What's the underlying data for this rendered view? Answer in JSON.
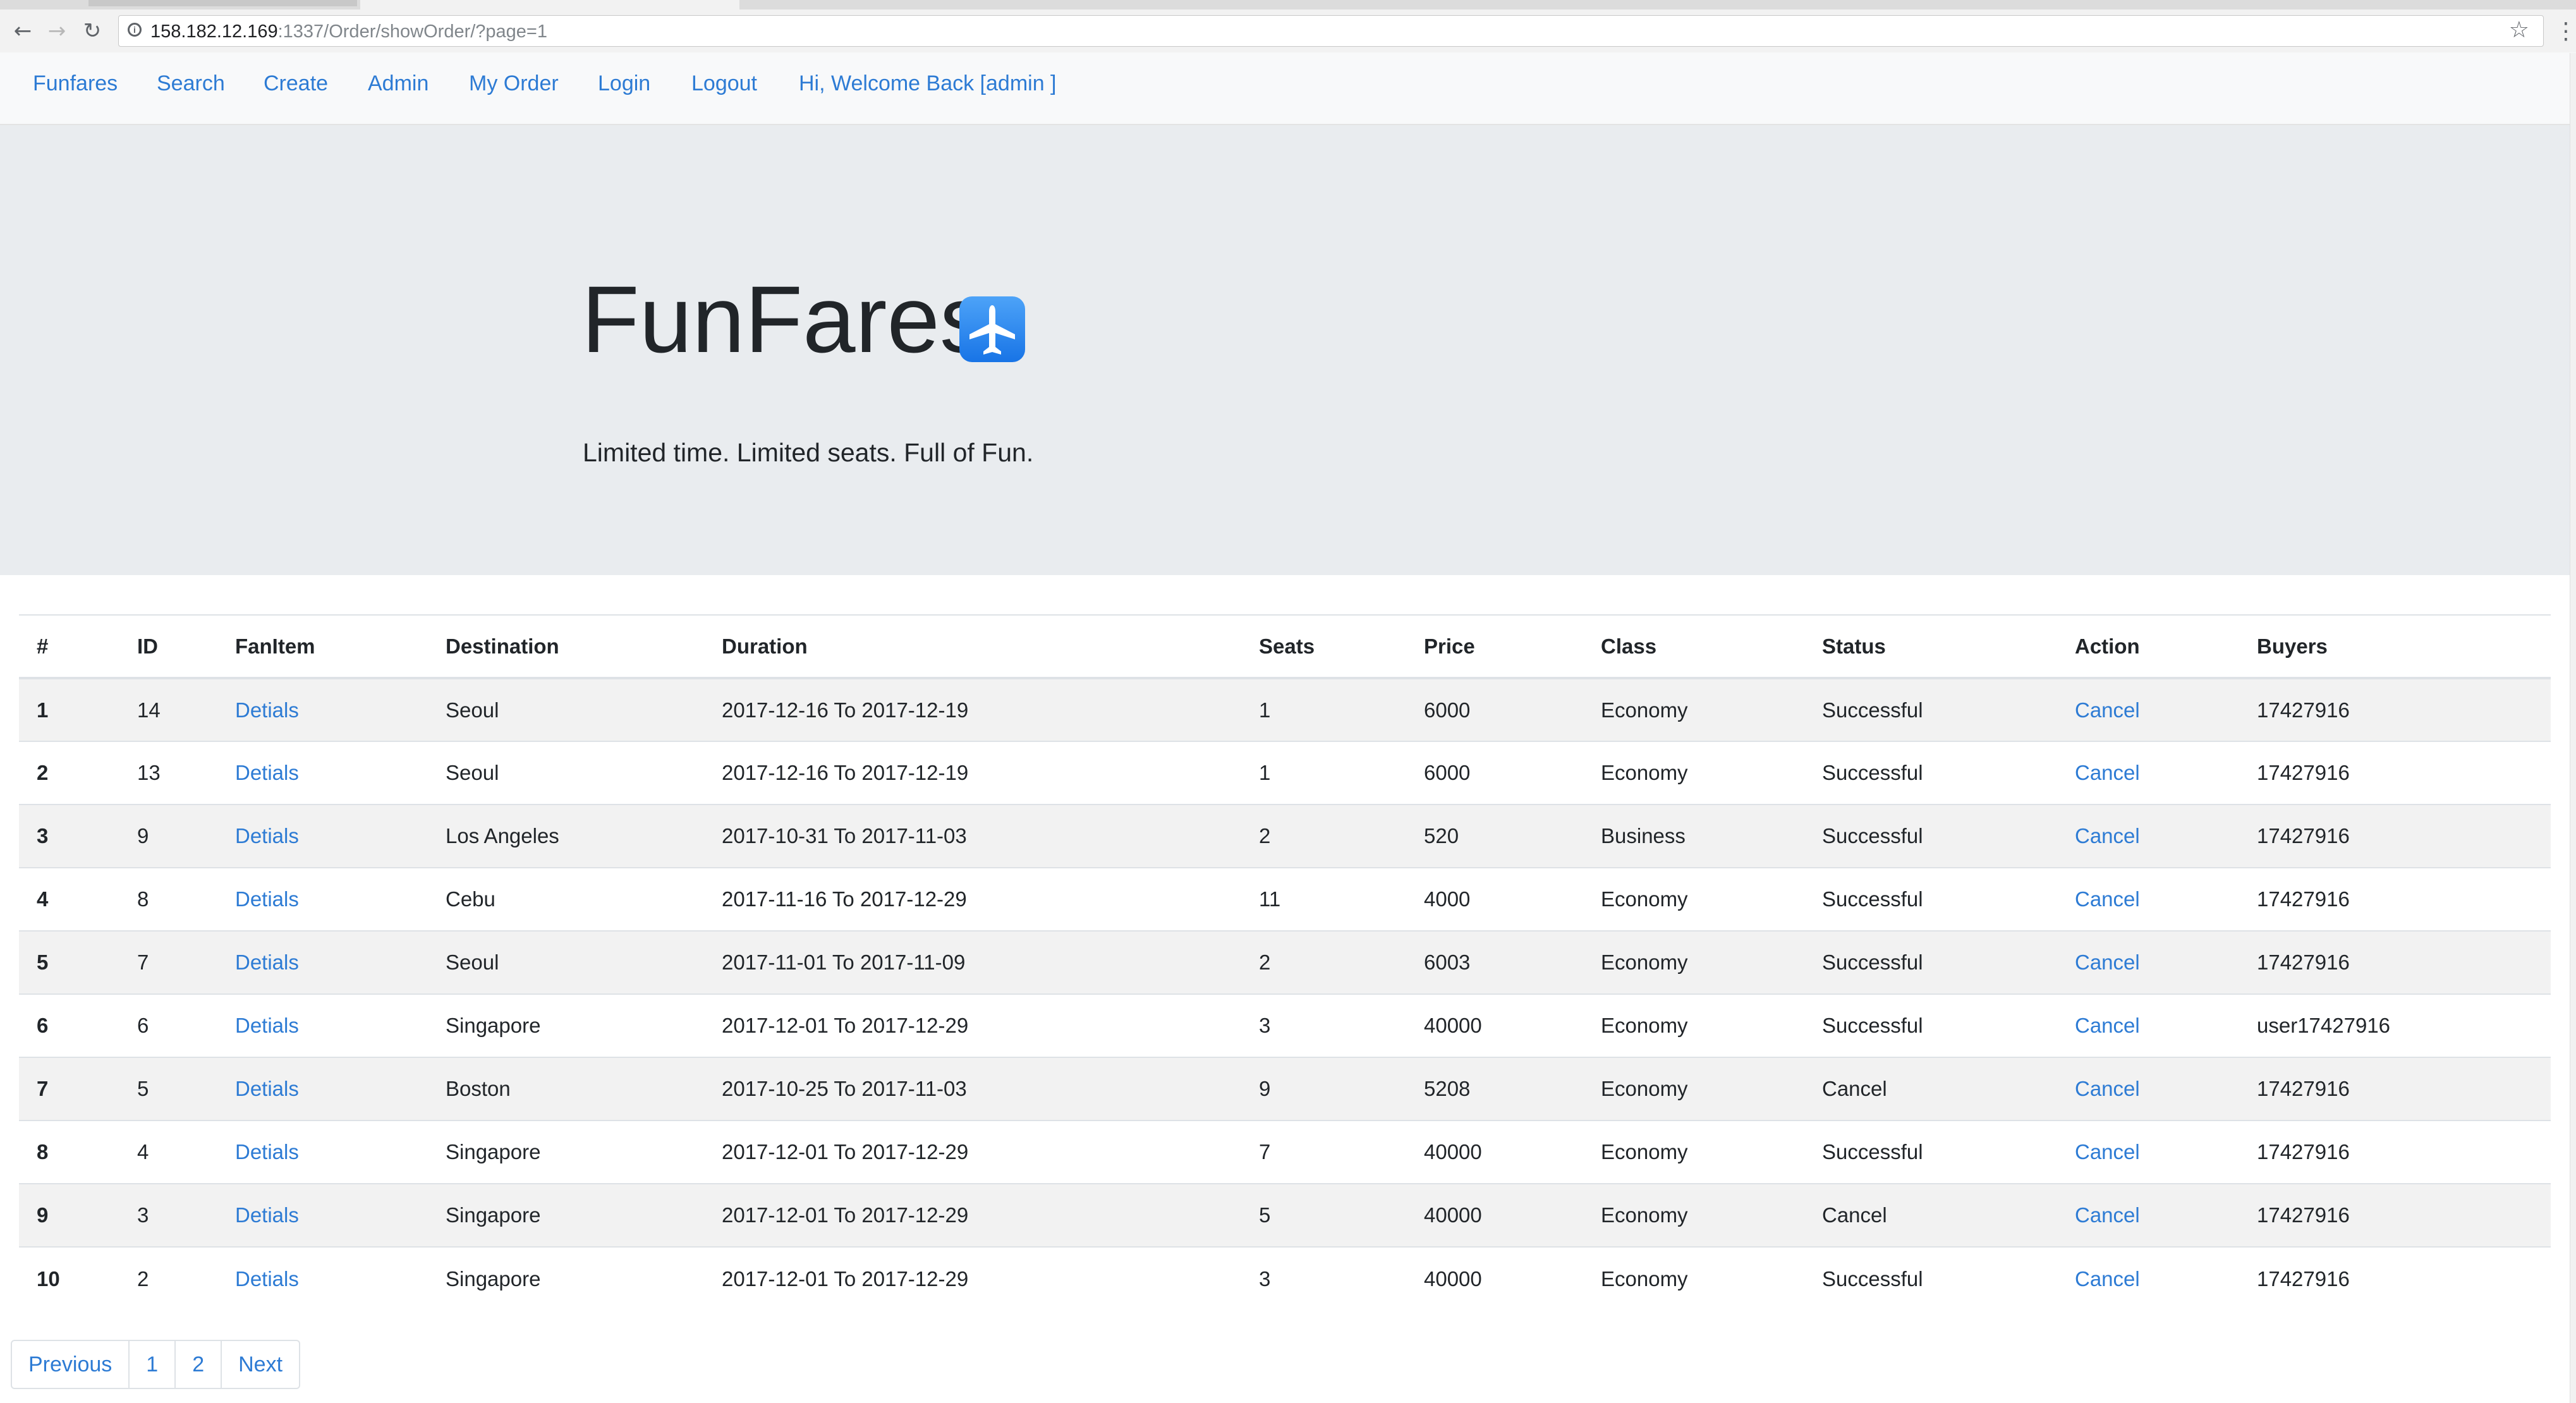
{
  "browser": {
    "url_host": "158.182.12.169",
    "url_path": ":1337/Order/showOrder/?page=1",
    "icons": {
      "back": "back-arrow-icon",
      "forward": "forward-arrow-icon",
      "reload": "reload-icon",
      "info": "info-icon",
      "star": "star-icon",
      "menu": "kebab-menu-icon"
    }
  },
  "navbar": {
    "items": [
      {
        "label": "Funfares"
      },
      {
        "label": "Search"
      },
      {
        "label": "Create"
      },
      {
        "label": "Admin"
      },
      {
        "label": "My Order"
      },
      {
        "label": "Login"
      },
      {
        "label": "Logout"
      },
      {
        "label": "Hi, Welcome Back [admin ]"
      }
    ]
  },
  "jumbotron": {
    "title": "FunFares",
    "icon": "airplane-icon",
    "lead": "Limited time. Limited seats. Full of Fun."
  },
  "table": {
    "columns": [
      "#",
      "ID",
      "FanItem",
      "Destination",
      "Duration",
      "Seats",
      "Price",
      "Class",
      "Status",
      "Action",
      "Buyers"
    ],
    "rows": [
      {
        "num": "1",
        "id": "14",
        "item": "Detials",
        "dest": "Seoul",
        "duration": "2017-12-16 To 2017-12-19",
        "seats": "1",
        "price": "6000",
        "class": "Economy",
        "status": "Successful",
        "action": "Cancel",
        "buyer": "17427916"
      },
      {
        "num": "2",
        "id": "13",
        "item": "Detials",
        "dest": "Seoul",
        "duration": "2017-12-16 To 2017-12-19",
        "seats": "1",
        "price": "6000",
        "class": "Economy",
        "status": "Successful",
        "action": "Cancel",
        "buyer": "17427916"
      },
      {
        "num": "3",
        "id": "9",
        "item": "Detials",
        "dest": "Los Angeles",
        "duration": "2017-10-31 To 2017-11-03",
        "seats": "2",
        "price": "520",
        "class": "Business",
        "status": "Successful",
        "action": "Cancel",
        "buyer": "17427916"
      },
      {
        "num": "4",
        "id": "8",
        "item": "Detials",
        "dest": "Cebu",
        "duration": "2017-11-16 To 2017-12-29",
        "seats": "11",
        "price": "4000",
        "class": "Economy",
        "status": "Successful",
        "action": "Cancel",
        "buyer": "17427916"
      },
      {
        "num": "5",
        "id": "7",
        "item": "Detials",
        "dest": "Seoul",
        "duration": "2017-11-01 To 2017-11-09",
        "seats": "2",
        "price": "6003",
        "class": "Economy",
        "status": "Successful",
        "action": "Cancel",
        "buyer": "17427916"
      },
      {
        "num": "6",
        "id": "6",
        "item": "Detials",
        "dest": "Singapore",
        "duration": "2017-12-01 To 2017-12-29",
        "seats": "3",
        "price": "40000",
        "class": "Economy",
        "status": "Successful",
        "action": "Cancel",
        "buyer": "user17427916"
      },
      {
        "num": "7",
        "id": "5",
        "item": "Detials",
        "dest": "Boston",
        "duration": "2017-10-25 To 2017-11-03",
        "seats": "9",
        "price": "5208",
        "class": "Economy",
        "status": "Cancel",
        "action": "Cancel",
        "buyer": "17427916"
      },
      {
        "num": "8",
        "id": "4",
        "item": "Detials",
        "dest": "Singapore",
        "duration": "2017-12-01 To 2017-12-29",
        "seats": "7",
        "price": "40000",
        "class": "Economy",
        "status": "Successful",
        "action": "Cancel",
        "buyer": "17427916"
      },
      {
        "num": "9",
        "id": "3",
        "item": "Detials",
        "dest": "Singapore",
        "duration": "2017-12-01 To 2017-12-29",
        "seats": "5",
        "price": "40000",
        "class": "Economy",
        "status": "Cancel",
        "action": "Cancel",
        "buyer": "17427916"
      },
      {
        "num": "10",
        "id": "2",
        "item": "Detials",
        "dest": "Singapore",
        "duration": "2017-12-01 To 2017-12-29",
        "seats": "3",
        "price": "40000",
        "class": "Economy",
        "status": "Successful",
        "action": "Cancel",
        "buyer": "17427916"
      }
    ]
  },
  "pagination": {
    "prev": "Previous",
    "pages": [
      "1",
      "2"
    ],
    "next": "Next"
  },
  "colors": {
    "link": "#2d7bd4",
    "jumbotron_bg": "#e9ecef",
    "navbar_bg": "#f8f9fa",
    "stripe": "#f2f2f2"
  }
}
